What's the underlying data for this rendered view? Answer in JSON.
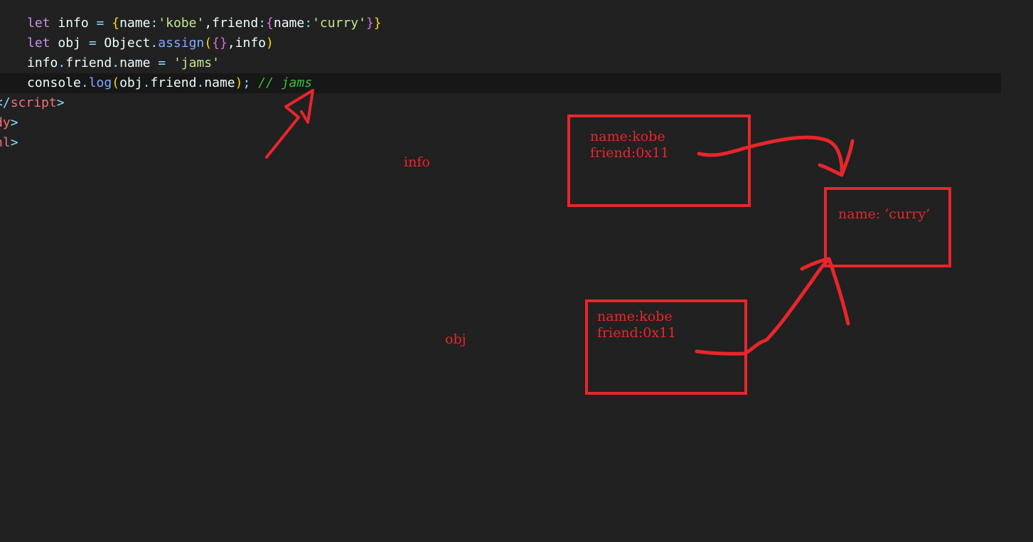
{
  "editor": {
    "lines": [
      {
        "tokens": [
          {
            "t": "let",
            "c": "kw"
          },
          {
            "t": " info ",
            "c": "plain"
          },
          {
            "t": "=",
            "c": "op"
          },
          {
            "t": " ",
            "c": "plain"
          },
          {
            "t": "{",
            "c": "brace1"
          },
          {
            "t": "name",
            "c": "plain"
          },
          {
            "t": ":",
            "c": "op"
          },
          {
            "t": "'kobe'",
            "c": "str"
          },
          {
            "t": ",",
            "c": "plain"
          },
          {
            "t": "friend",
            "c": "plain"
          },
          {
            "t": ":",
            "c": "op"
          },
          {
            "t": "{",
            "c": "brace2"
          },
          {
            "t": "name",
            "c": "plain"
          },
          {
            "t": ":",
            "c": "op"
          },
          {
            "t": "'curry'",
            "c": "str"
          },
          {
            "t": "}",
            "c": "brace2"
          },
          {
            "t": "}",
            "c": "brace1"
          }
        ]
      },
      {
        "tokens": [
          {
            "t": "let",
            "c": "kw"
          },
          {
            "t": " obj ",
            "c": "plain"
          },
          {
            "t": "=",
            "c": "op"
          },
          {
            "t": " Object",
            "c": "plain"
          },
          {
            "t": ".",
            "c": "op"
          },
          {
            "t": "assign",
            "c": "fn"
          },
          {
            "t": "(",
            "c": "brace1"
          },
          {
            "t": "{}",
            "c": "brace2"
          },
          {
            "t": ",info",
            "c": "plain"
          },
          {
            "t": ")",
            "c": "brace1"
          }
        ]
      },
      {
        "tokens": [
          {
            "t": "info",
            "c": "plain"
          },
          {
            "t": ".",
            "c": "op"
          },
          {
            "t": "friend",
            "c": "plain"
          },
          {
            "t": ".",
            "c": "op"
          },
          {
            "t": "name ",
            "c": "plain"
          },
          {
            "t": "=",
            "c": "op"
          },
          {
            "t": " ",
            "c": "plain"
          },
          {
            "t": "'jams'",
            "c": "str"
          }
        ]
      },
      {
        "current": true,
        "tokens": [
          {
            "t": "console",
            "c": "plain"
          },
          {
            "t": ".",
            "c": "op"
          },
          {
            "t": "log",
            "c": "fn"
          },
          {
            "t": "(",
            "c": "brace1"
          },
          {
            "t": "obj",
            "c": "plain"
          },
          {
            "t": ".",
            "c": "op"
          },
          {
            "t": "friend",
            "c": "plain"
          },
          {
            "t": ".",
            "c": "op"
          },
          {
            "t": "name",
            "c": "plain"
          },
          {
            "t": ")",
            "c": "brace1"
          },
          {
            "t": ";",
            "c": "punct"
          },
          {
            "t": " // jams",
            "c": "cmt"
          }
        ]
      },
      {
        "outdent": true,
        "tokens": [
          {
            "t": "</",
            "c": "punct"
          },
          {
            "t": "script",
            "c": "tag"
          },
          {
            "t": ">",
            "c": "punct"
          }
        ]
      },
      {
        "outdent": true,
        "tokens": [
          {
            "t": "dy",
            "c": "tag"
          },
          {
            "t": ">",
            "c": "punct"
          }
        ]
      },
      {
        "outdent": true,
        "tokens": [
          {
            "t": "nl",
            "c": "tag"
          },
          {
            "t": ">",
            "c": "punct"
          }
        ]
      }
    ]
  },
  "annotations": {
    "info_label": "info",
    "obj_label": "obj",
    "info_box": {
      "line1": "name:kobe",
      "line2": "friend:0x11"
    },
    "obj_box": {
      "line1": "name:kobe",
      "line2": "friend:0x11"
    },
    "friend_box": {
      "line1": "name: ‘curry’"
    },
    "ink_color": "#e8262c"
  }
}
